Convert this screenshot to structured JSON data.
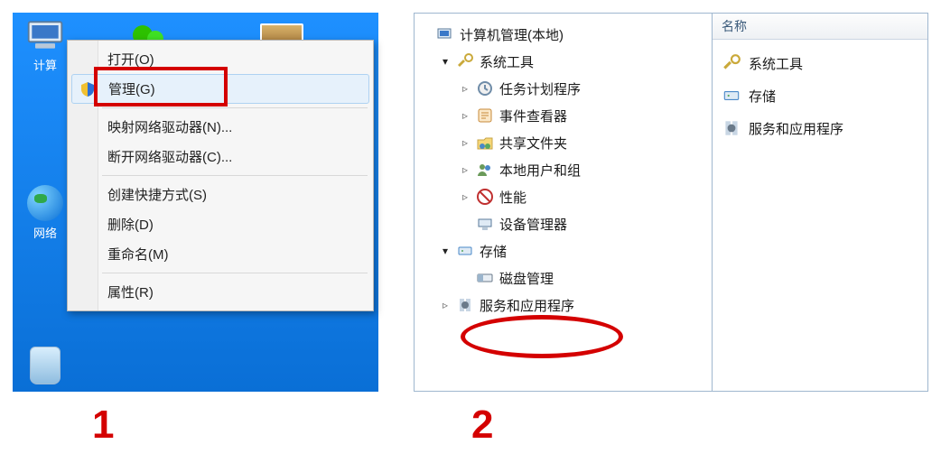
{
  "desktop": {
    "computer_label": "计算",
    "network_label": "网络"
  },
  "context_menu": {
    "open": "打开(O)",
    "manage": "管理(G)",
    "map_drive": "映射网络驱动器(N)...",
    "disconnect_drive": "断开网络驱动器(C)...",
    "create_shortcut": "创建快捷方式(S)",
    "delete": "删除(D)",
    "rename": "重命名(M)",
    "properties": "属性(R)"
  },
  "tree": {
    "root": "计算机管理(本地)",
    "system_tools": "系统工具",
    "task_scheduler": "任务计划程序",
    "event_viewer": "事件查看器",
    "shared_folders": "共享文件夹",
    "local_users": "本地用户和组",
    "performance": "性能",
    "device_manager": "设备管理器",
    "storage": "存储",
    "disk_management": "磁盘管理",
    "services_apps": "服务和应用程序"
  },
  "list": {
    "header": "名称",
    "system_tools": "系统工具",
    "storage": "存储",
    "services_apps": "服务和应用程序"
  },
  "steps": {
    "one": "1",
    "two": "2"
  }
}
